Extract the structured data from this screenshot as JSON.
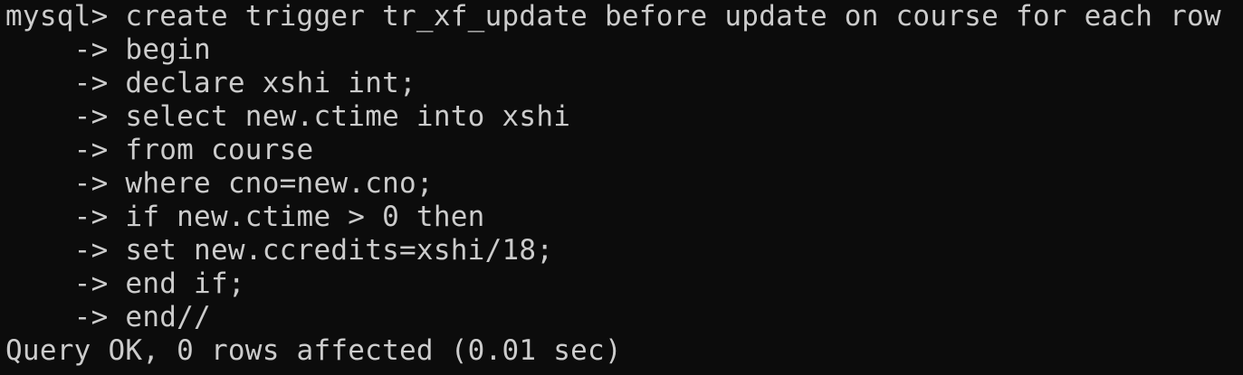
{
  "terminal": {
    "lines": [
      {
        "prefix": "mysql> ",
        "text": "create trigger tr_xf_update before update on course for each row"
      },
      {
        "prefix": "    -> ",
        "text": "begin"
      },
      {
        "prefix": "    -> ",
        "text": "declare xshi int;"
      },
      {
        "prefix": "    -> ",
        "text": "select new.ctime into xshi"
      },
      {
        "prefix": "    -> ",
        "text": "from course"
      },
      {
        "prefix": "    -> ",
        "text": "where cno=new.cno;"
      },
      {
        "prefix": "    -> ",
        "text": "if new.ctime > 0 then"
      },
      {
        "prefix": "    -> ",
        "text": "set new.ccredits=xshi/18;"
      },
      {
        "prefix": "    -> ",
        "text": "end if;"
      },
      {
        "prefix": "    -> ",
        "text": "end//"
      },
      {
        "prefix": "",
        "text": "Query OK, 0 rows affected (0.01 sec)"
      }
    ]
  },
  "colors": {
    "background": "#0c0c0c",
    "foreground": "#cccccc"
  }
}
